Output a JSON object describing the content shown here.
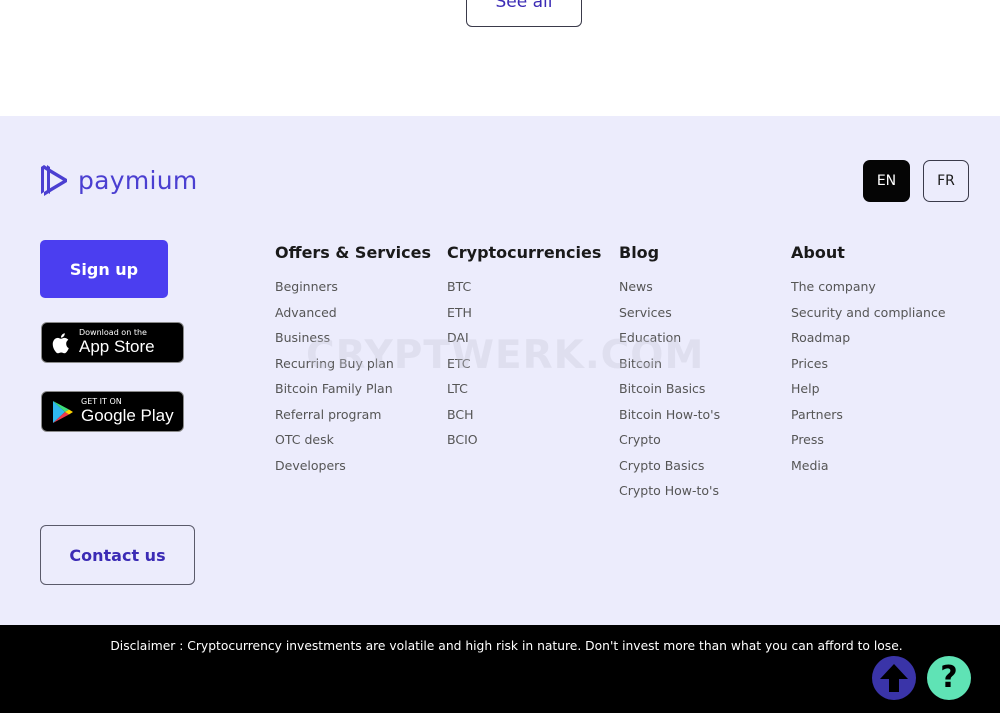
{
  "top": {
    "see_all_label": "See all"
  },
  "footer": {
    "logo_text": "paymium",
    "languages": [
      {
        "code": "EN",
        "active": true
      },
      {
        "code": "FR",
        "active": false
      }
    ],
    "signup_label": "Sign up",
    "app_store": {
      "small": "Download on the",
      "big": "App Store"
    },
    "google_play": {
      "small": "GET IT ON",
      "big": "Google Play"
    },
    "contact_label": "Contact us",
    "columns": [
      {
        "title": "Offers & Services",
        "items": [
          "Beginners",
          "Advanced",
          "Business",
          "Recurring Buy plan",
          "Bitcoin Family Plan",
          "Referral program",
          "OTC desk",
          "Developers"
        ]
      },
      {
        "title": "Cryptocurrencies",
        "items": [
          "BTC",
          "ETH",
          "DAI",
          "ETC",
          "LTC",
          "BCH",
          "BCIO"
        ]
      },
      {
        "title": "Blog",
        "items": [
          "News",
          "Services",
          "Education",
          "Bitcoin",
          "Bitcoin Basics",
          "Bitcoin How-to's",
          "Crypto",
          "Crypto Basics",
          "Crypto How-to's"
        ]
      },
      {
        "title": "About",
        "items": [
          "The company",
          "Security and compliance",
          "Roadmap",
          "Prices",
          "Help",
          "Partners",
          "Press",
          "Media"
        ]
      }
    ],
    "watermark": "CRYPTWERK.COM"
  },
  "bottom": {
    "disclaimer": "Disclaimer : Cryptocurrency investments are volatile and high risk in nature. Don't invest more than what you can afford to lose.",
    "help_glyph": "?"
  },
  "colors": {
    "brand": "#4b3fd1",
    "signup_bg": "#4b3ef0",
    "footer_bg": "#ececfc",
    "scroll_up_bg": "#3a34a8",
    "help_bg": "#5fe3b5"
  },
  "icons": [
    "paymium-logo-icon",
    "apple-icon",
    "google-play-icon",
    "arrow-up-icon",
    "help-icon"
  ]
}
